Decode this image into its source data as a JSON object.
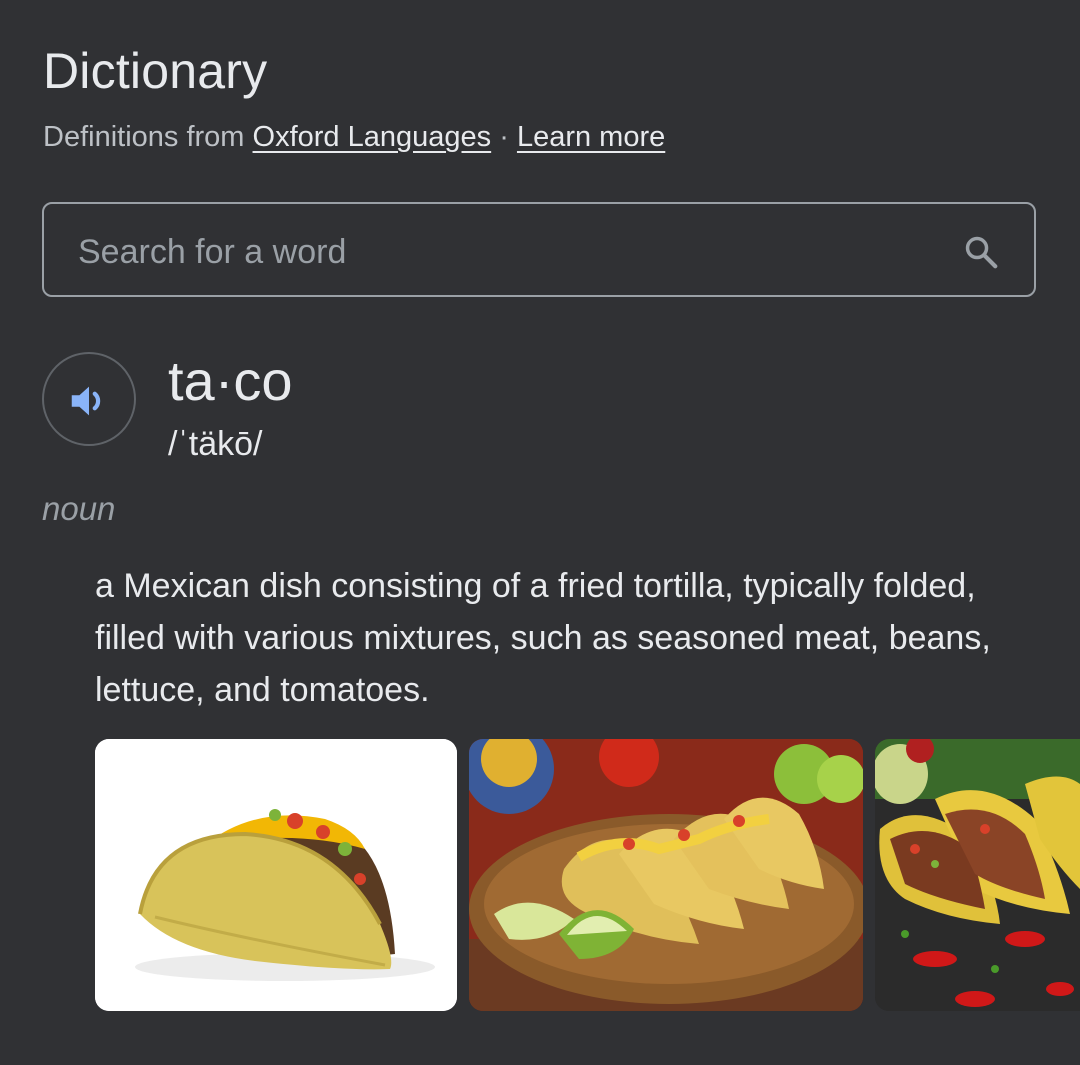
{
  "header": {
    "title": "Dictionary",
    "source_prefix": "Definitions from",
    "source_link": "Oxford Languages",
    "separator": "·",
    "learn_more": "Learn more"
  },
  "search": {
    "placeholder": "Search for a word",
    "value": "",
    "icon": "search-icon"
  },
  "entry": {
    "word": "ta·co",
    "phonetic": "/ˈtäkō/",
    "audio_icon": "speaker-icon",
    "part_of_speech": "noun",
    "definition": "a Mexican dish consisting of a fried tortilla, typically folded, filled with various mixtures, such as seasoned meat, beans, lettuce, and tomatoes."
  },
  "images": [
    {
      "name": "single-taco-image"
    },
    {
      "name": "tacos-on-plate-image"
    },
    {
      "name": "tacos-on-slate-image"
    }
  ],
  "colors": {
    "background": "#303134",
    "text": "#e8eaed",
    "muted": "#9aa0a6",
    "accent": "#8ab4f8"
  }
}
